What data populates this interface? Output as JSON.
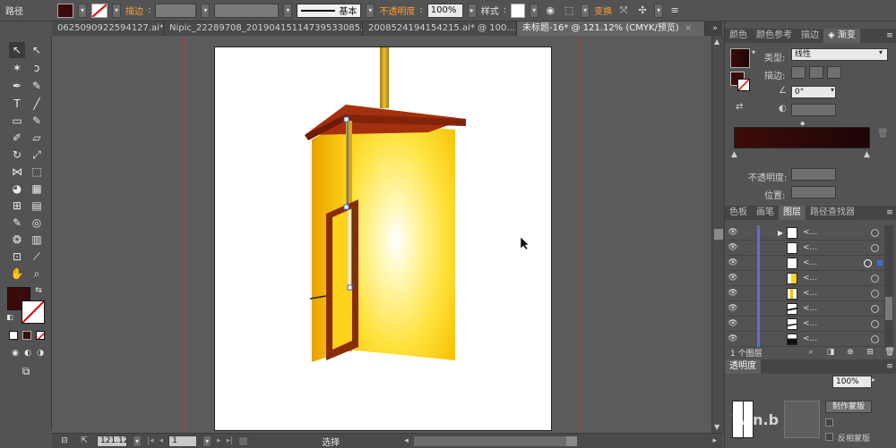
{
  "control_bar": {
    "object_type": "路径",
    "stroke_label": "描边",
    "stroke_weight": "",
    "brush_def": "基本",
    "opacity_label": "不透明度",
    "opacity_value": "100%",
    "style_label": "样式",
    "transform_label": "变换"
  },
  "tabs": [
    {
      "label": "0625090922594127.ai*",
      "active": false
    },
    {
      "label": "Nipic_22289708_20190415114739533085.ai*",
      "active": false
    },
    {
      "label": "2008524194154215.ai* @ 100...",
      "active": false
    },
    {
      "label": "未标题-16* @ 121.12% (CMYK/预览)",
      "active": true
    }
  ],
  "status_bar": {
    "zoom": "121.12",
    "page": "1",
    "mode": "选择"
  },
  "panels": {
    "top_tabs": [
      "颜色",
      "颜色参考",
      "描边",
      "渐变"
    ],
    "gradient": {
      "type_label": "类型",
      "type_value": "线性",
      "stroke_label": "描边",
      "angle_value": "0°",
      "opacity_label": "不透明度",
      "location_label": "位置"
    },
    "layer_tabs": [
      "色板",
      "画笔",
      "图层",
      "路径查找器"
    ],
    "layers_count": "1 个图层",
    "layer_rows": [
      "<...",
      "<...",
      "<...",
      "<...",
      "<...",
      "<...",
      "<...",
      "<..."
    ],
    "transparency": {
      "tab": "透明度",
      "opacity_value": "100%",
      "make_mask": "制作蒙版",
      "invert_mask": "反相蒙版",
      "watermark": "Win.b"
    }
  },
  "colors": {
    "fill": "#3b0b0b",
    "gradient_start": "#3d0b09",
    "gradient_end": "#1c0606",
    "accent_orange": "#ff9d33",
    "guide_red": "#c0392b"
  }
}
